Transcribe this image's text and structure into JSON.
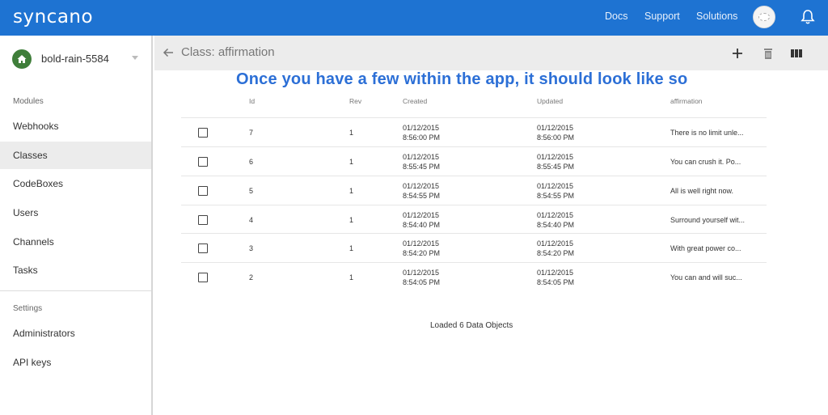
{
  "topbar": {
    "logo": "syncano",
    "nav": [
      "Docs",
      "Support",
      "Solutions"
    ]
  },
  "sidebar": {
    "instance_name": "bold-rain-5584",
    "modules_label": "Modules",
    "modules": [
      {
        "label": "Webhooks",
        "active": false
      },
      {
        "label": "Classes",
        "active": true
      },
      {
        "label": "CodeBoxes",
        "active": false
      },
      {
        "label": "Users",
        "active": false
      },
      {
        "label": "Channels",
        "active": false
      },
      {
        "label": "Tasks",
        "active": false
      }
    ],
    "settings_label": "Settings",
    "settings": [
      {
        "label": "Administrators"
      },
      {
        "label": "API keys"
      }
    ]
  },
  "header": {
    "title": "Class: affirmation"
  },
  "annotation": "Once you have a few within the app, it should look like so",
  "table": {
    "columns": [
      "Id",
      "Rev",
      "Created",
      "Updated",
      "affirmation"
    ],
    "rows": [
      {
        "id": "7",
        "rev": "1",
        "created_date": "01/12/2015",
        "created_time": "8:56:00 PM",
        "updated_date": "01/12/2015",
        "updated_time": "8:56:00 PM",
        "affirmation": "There is no limit unle..."
      },
      {
        "id": "6",
        "rev": "1",
        "created_date": "01/12/2015",
        "created_time": "8:55:45 PM",
        "updated_date": "01/12/2015",
        "updated_time": "8:55:45 PM",
        "affirmation": "You can crush it. Po..."
      },
      {
        "id": "5",
        "rev": "1",
        "created_date": "01/12/2015",
        "created_time": "8:54:55 PM",
        "updated_date": "01/12/2015",
        "updated_time": "8:54:55 PM",
        "affirmation": "All is well right now."
      },
      {
        "id": "4",
        "rev": "1",
        "created_date": "01/12/2015",
        "created_time": "8:54:40 PM",
        "updated_date": "01/12/2015",
        "updated_time": "8:54:40 PM",
        "affirmation": "Surround yourself wit..."
      },
      {
        "id": "3",
        "rev": "1",
        "created_date": "01/12/2015",
        "created_time": "8:54:20 PM",
        "updated_date": "01/12/2015",
        "updated_time": "8:54:20 PM",
        "affirmation": "With great power co..."
      },
      {
        "id": "2",
        "rev": "1",
        "created_date": "01/12/2015",
        "created_time": "8:54:05 PM",
        "updated_date": "01/12/2015",
        "updated_time": "8:54:05 PM",
        "affirmation": "You can and will suc..."
      }
    ],
    "footer": "Loaded 6 Data Objects"
  },
  "icons": {
    "instance": "home-icon",
    "back": "arrow-left-icon",
    "add": "plus-icon",
    "delete": "trash-icon",
    "columns": "columns-icon",
    "notifications": "bell-icon"
  },
  "colors": {
    "brand": "#1e73d2",
    "instance": "#3f7e3a",
    "annotation": "#2c6fd6"
  }
}
